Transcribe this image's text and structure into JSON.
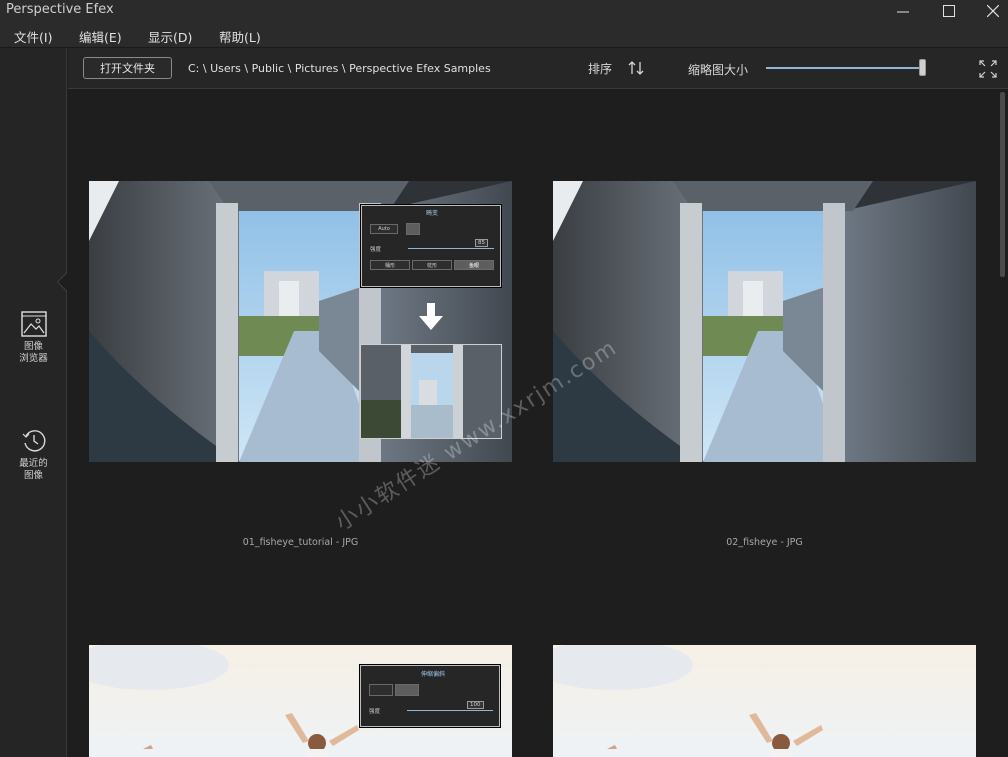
{
  "window": {
    "title": "Perspective Efex"
  },
  "menu": {
    "items": [
      {
        "label": "文件(I)"
      },
      {
        "label": "编辑(E)"
      },
      {
        "label": "显示(D)"
      },
      {
        "label": "帮助(L)"
      }
    ]
  },
  "sidebar": {
    "browser_label_1": "图像",
    "browser_label_2": "浏览器",
    "recent_label_1": "最近的",
    "recent_label_2": "图像"
  },
  "toolbar": {
    "open_folder": "打开文件夹",
    "path": "C: \\ Users \\ Public \\ Pictures \\ Perspective Efex Samples",
    "sort_label": "排序",
    "thumb_size_label": "缩略图大小",
    "thumb_size_value": 1.0
  },
  "images": [
    {
      "caption": "01_fisheye_tutorial - JPG"
    },
    {
      "caption": "02_fisheye - JPG"
    },
    {
      "caption": ""
    },
    {
      "caption": ""
    }
  ],
  "overlay1": {
    "title": "畸变",
    "auto": "Auto",
    "strength_label": "强度",
    "strength_value": "85",
    "modes": [
      "桶形",
      "枕形",
      "鱼眼"
    ]
  },
  "overlay2": {
    "title": "伸缩偏斜",
    "strength_label": "强度",
    "strength_value": "100"
  },
  "watermark": "小小软件迷 www.xxrjm.com",
  "colors": {
    "accent": "#8fb6d8",
    "background": "#1e1e1e"
  }
}
